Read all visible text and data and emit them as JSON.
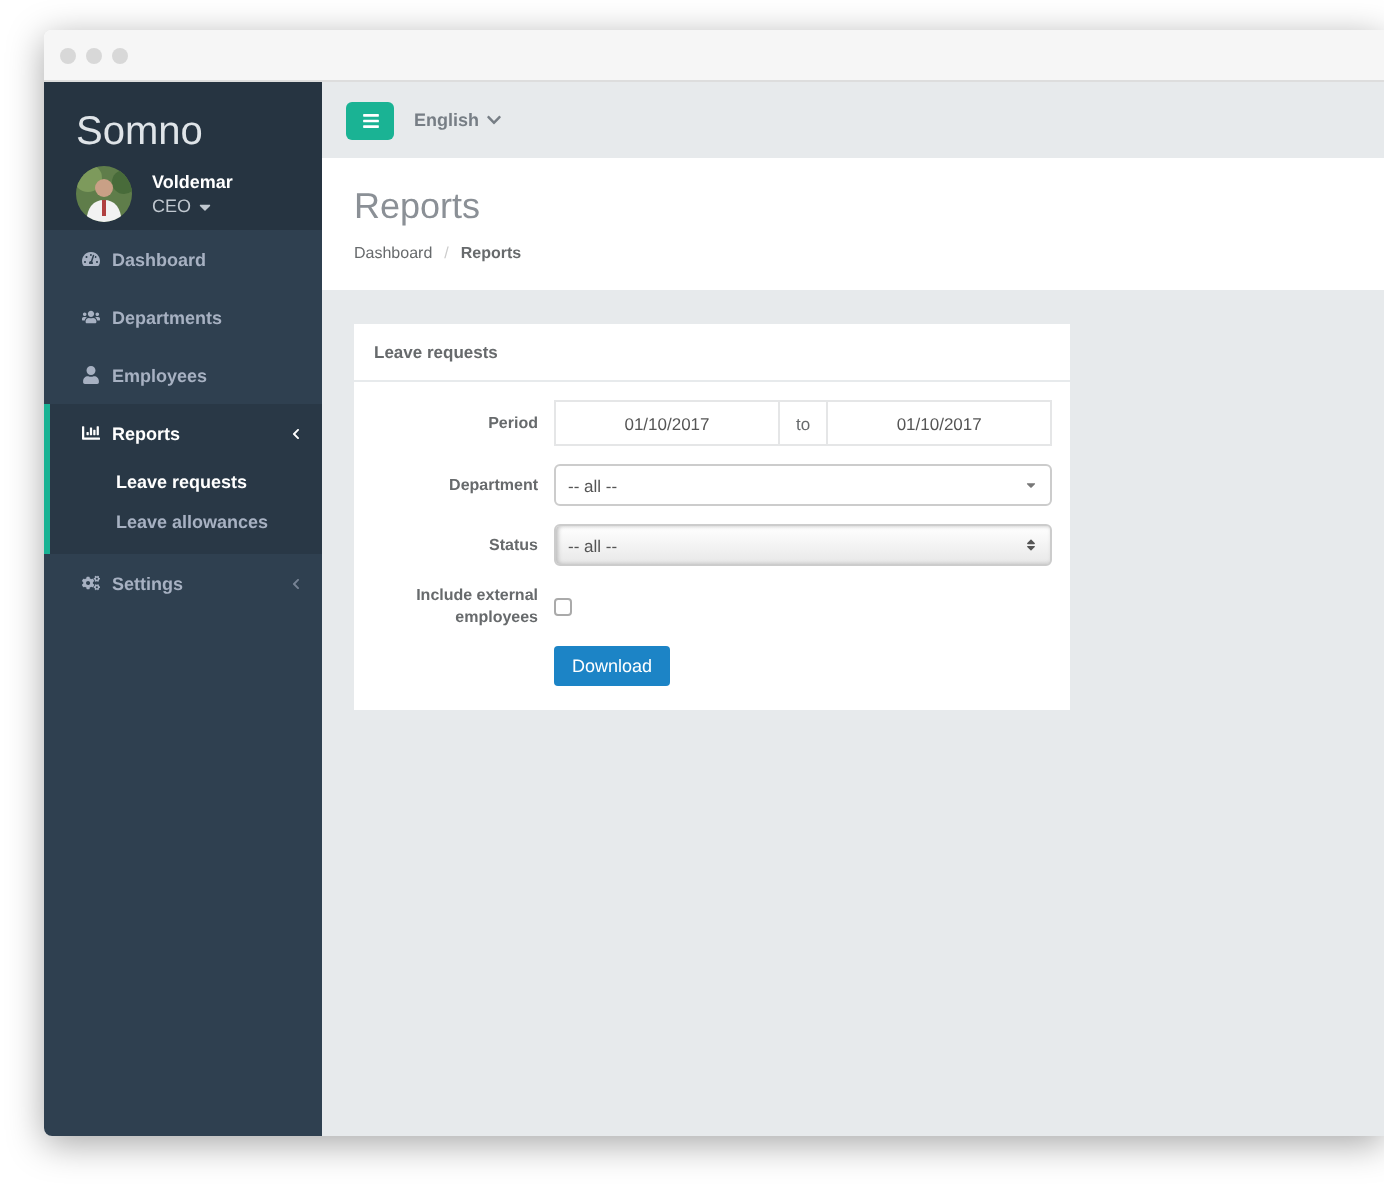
{
  "brand": "Somno",
  "user": {
    "name": "Voldemar",
    "role": "CEO"
  },
  "sidebar": {
    "items": [
      {
        "label": "Dashboard",
        "selected": false
      },
      {
        "label": "Departments",
        "selected": false
      },
      {
        "label": "Employees",
        "selected": false
      },
      {
        "label": "Reports",
        "selected": true,
        "expanded": true,
        "children": [
          {
            "label": "Leave requests",
            "selected": true
          },
          {
            "label": "Leave allowances",
            "selected": false
          }
        ]
      },
      {
        "label": "Settings",
        "selected": false,
        "expanded": false
      }
    ]
  },
  "topbar": {
    "language": "English"
  },
  "page": {
    "title": "Reports",
    "breadcrumb_separator": "/",
    "breadcrumbs": [
      {
        "label": "Dashboard",
        "current": false
      },
      {
        "label": "Reports",
        "current": true
      }
    ]
  },
  "panel": {
    "title": "Leave requests",
    "period": {
      "label": "Period",
      "from": "01/10/2017",
      "separator": "to",
      "to": "01/10/2017"
    },
    "department": {
      "label": "Department",
      "value": "-- all --"
    },
    "status": {
      "label": "Status",
      "value": "-- all --"
    },
    "external": {
      "label": "Include external employees",
      "checked": false
    },
    "button": "Download"
  }
}
